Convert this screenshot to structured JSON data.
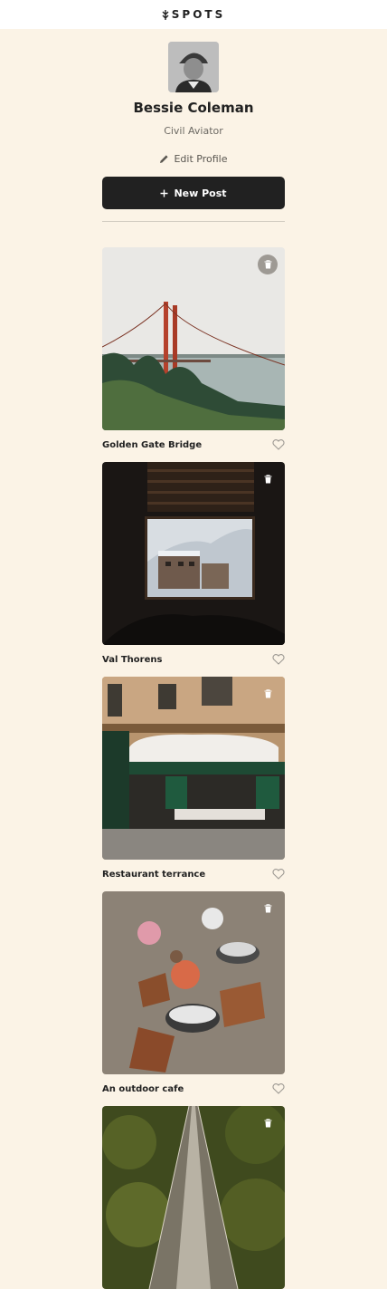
{
  "header": {
    "logo_text": "SPOTS",
    "logo_icon": "spots-logo-icon"
  },
  "profile": {
    "name": "Bessie Coleman",
    "description": "Civil Aviator",
    "edit_label": "Edit Profile",
    "new_post_label": "New Post"
  },
  "cards": [
    {
      "title": "Golden Gate Bridge"
    },
    {
      "title": "Val Thorens"
    },
    {
      "title": "Restaurant terrance"
    },
    {
      "title": "An outdoor cafe"
    },
    {
      "title": ""
    }
  ]
}
